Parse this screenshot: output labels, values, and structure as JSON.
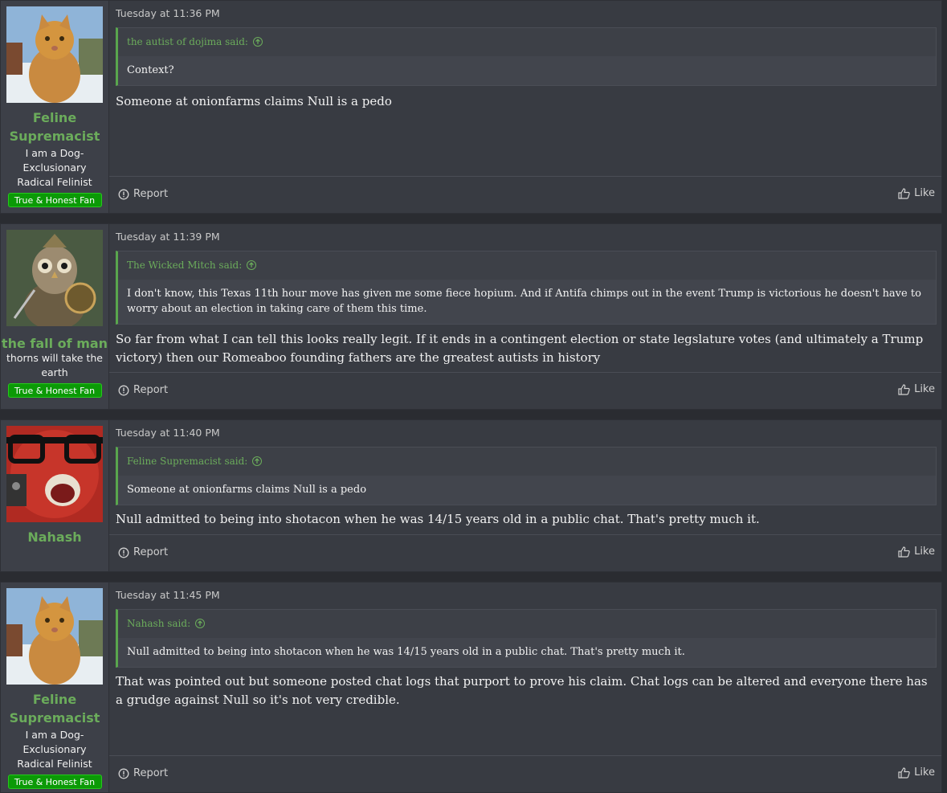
{
  "posts": [
    {
      "user": {
        "name": "Feline Supremacist",
        "title": "I am a Dog-Exclusionary Radical Felinist",
        "badge": "True & Honest Fan",
        "avatar": "orange-cat-avatar"
      },
      "time": "Tuesday at 11:36 PM",
      "quote": {
        "author": "the autist of dojima said:",
        "text": "Context?"
      },
      "message": "Someone at onionfarms claims Null is a pedo",
      "report": "Report",
      "like": "Like"
    },
    {
      "user": {
        "name": "the fall of man",
        "title": "thorns will take the earth",
        "badge": "True & Honest Fan",
        "avatar": "owl-warrior-avatar"
      },
      "time": "Tuesday at 11:39 PM",
      "quote": {
        "author": "The Wicked Mitch said:",
        "text": "I don't know, this Texas 11th hour move has given me some fiece hopium. And if Antifa chimps out in the event Trump is victorious he doesn't have to worry about an election in taking care of them this time."
      },
      "message": "So far from what I can tell this looks really legit. If it ends in a contingent election or state legslature votes (and ultimately a Trump victory) then our Romeaboo founding fathers are the greatest autists in history",
      "report": "Report",
      "like": "Like"
    },
    {
      "user": {
        "name": "Nahash",
        "title": "",
        "badge": "",
        "avatar": "red-face-glasses-avatar"
      },
      "time": "Tuesday at 11:40 PM",
      "quote": {
        "author": "Feline Supremacist said:",
        "text": "Someone at onionfarms claims Null is a pedo"
      },
      "message": "Null admitted to being into shotacon when he was 14/15 years old in a public chat. That's pretty much it.",
      "report": "Report",
      "like": "Like"
    },
    {
      "user": {
        "name": "Feline Supremacist",
        "title": "I am a Dog-Exclusionary Radical Felinist",
        "badge": "True & Honest Fan",
        "avatar": "orange-cat-avatar"
      },
      "time": "Tuesday at 11:45 PM",
      "quote": {
        "author": "Nahash said:",
        "text": "Null admitted to being into shotacon when he was 14/15 years old in a public chat. That's pretty much it."
      },
      "message": "That was pointed out but someone posted chat logs that purport to prove his claim. Chat logs can be altered and everyone there has a grudge against Null so it's not very credible.",
      "report": "Report",
      "like": "Like"
    }
  ],
  "colors": {
    "accent": "#6bac5b",
    "badge": "#0b9a06",
    "background": "#2a2c31",
    "post": "#383b42"
  }
}
